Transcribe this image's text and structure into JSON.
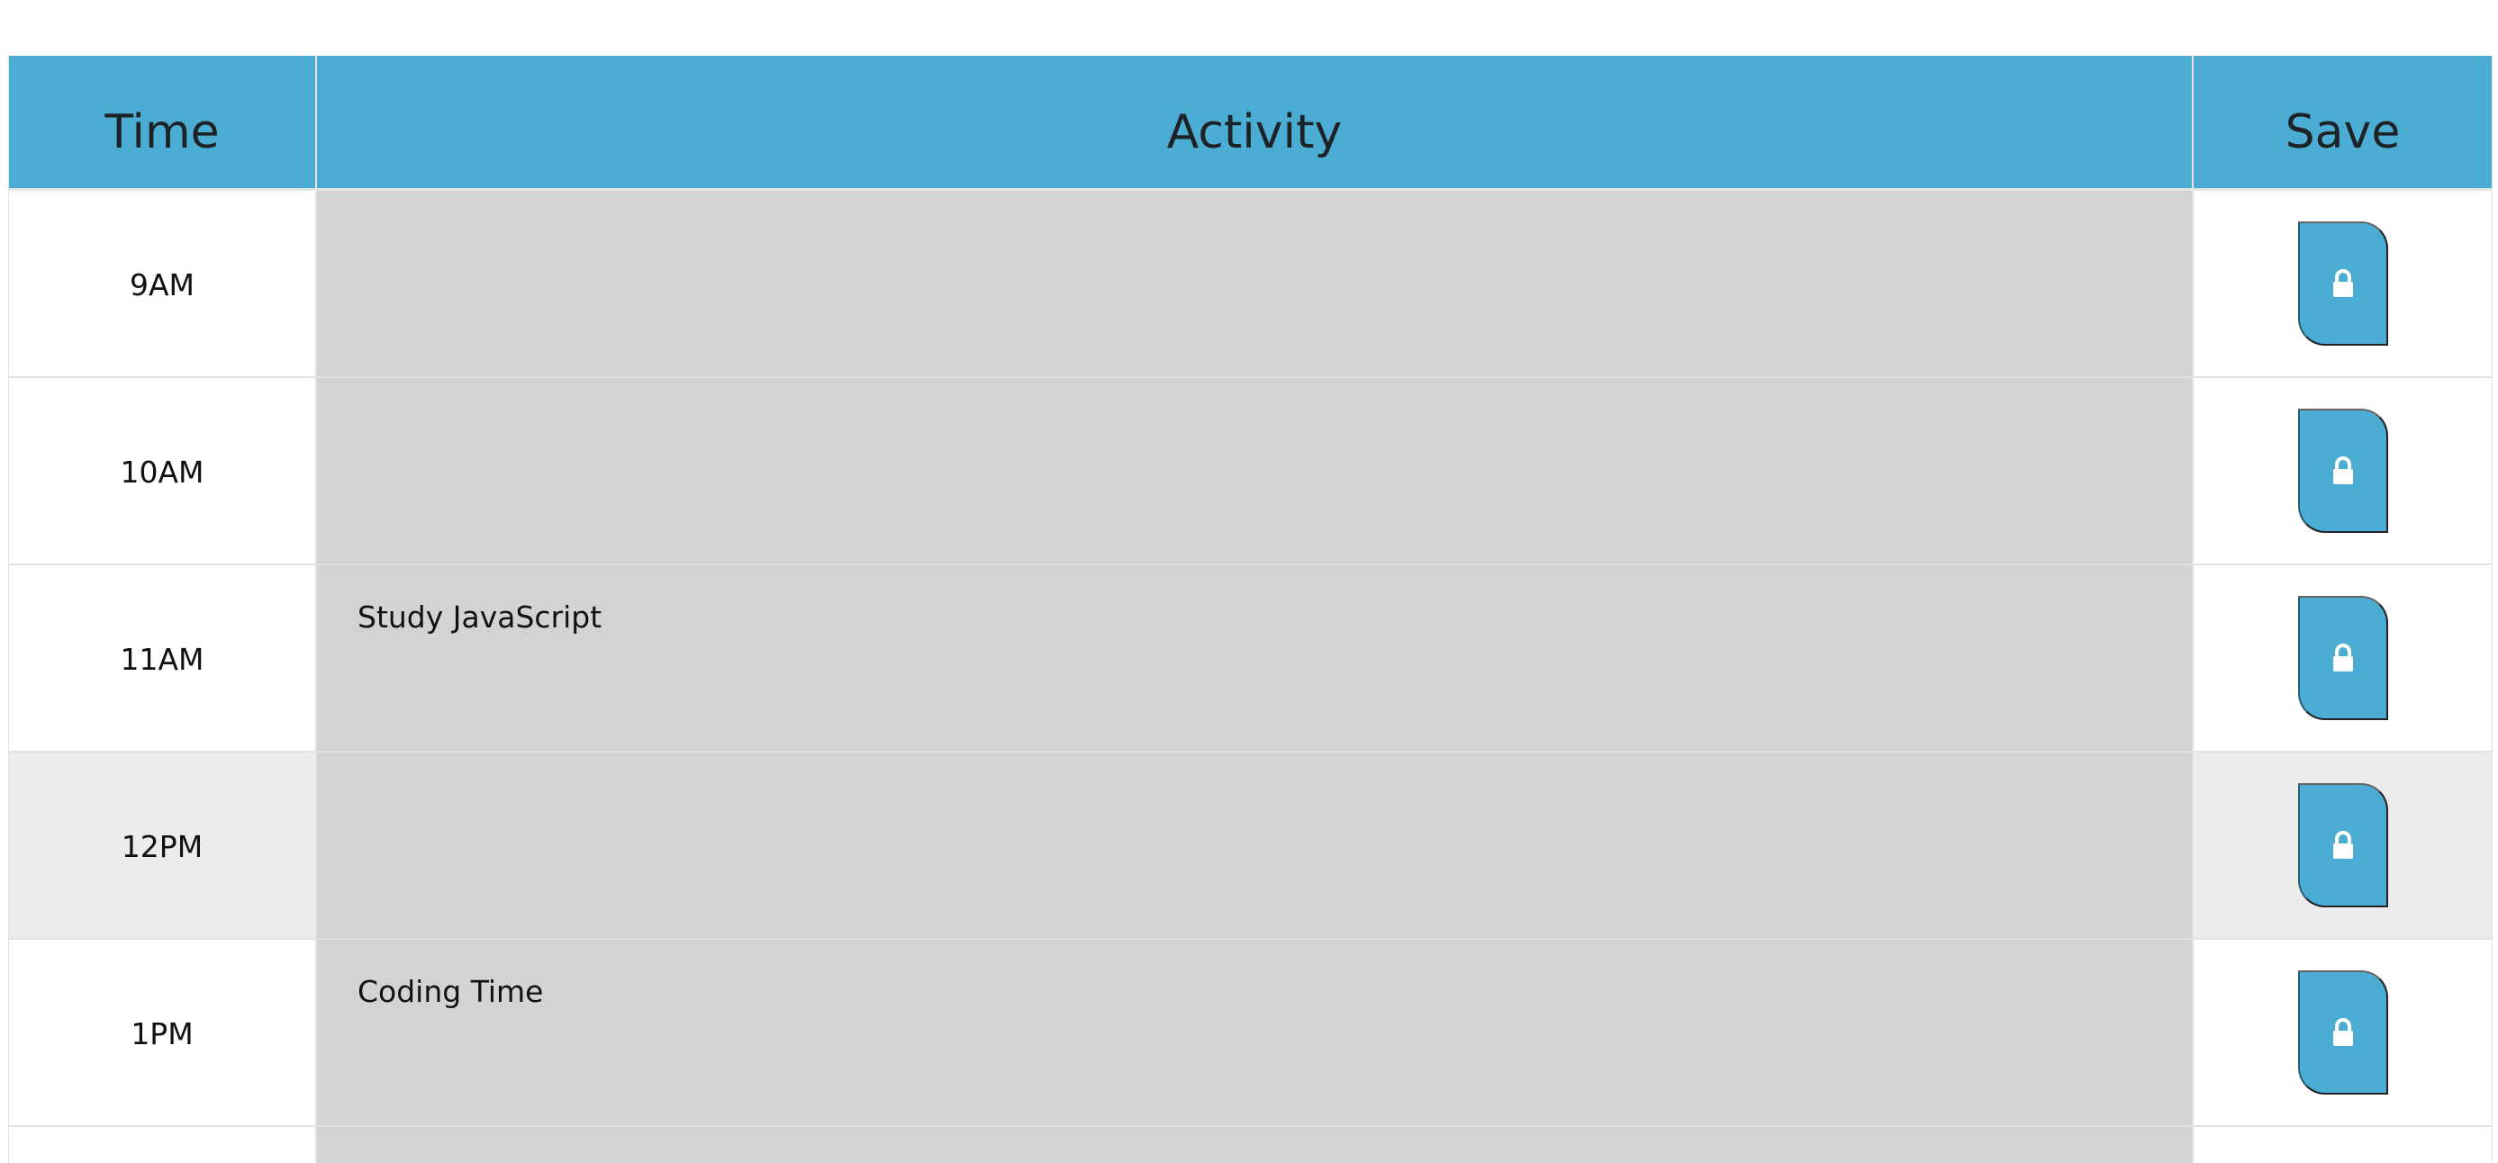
{
  "header": {
    "time_label": "Time",
    "activity_label": "Activity",
    "save_label": "Save"
  },
  "slots": [
    {
      "time": "9AM",
      "activity": "",
      "shaded": false
    },
    {
      "time": "10AM",
      "activity": "",
      "shaded": false
    },
    {
      "time": "11AM",
      "activity": "Study JavaScript",
      "shaded": false
    },
    {
      "time": "12PM",
      "activity": "",
      "shaded": true
    },
    {
      "time": "1PM",
      "activity": "Coding Time",
      "shaded": false
    }
  ],
  "icons": {
    "save": "lock-icon"
  },
  "colors": {
    "header_bg": "#4badd3",
    "activity_bg": "#d3d3d3",
    "shaded_row_bg": "#ececec",
    "button_bg": "#4badd3"
  }
}
